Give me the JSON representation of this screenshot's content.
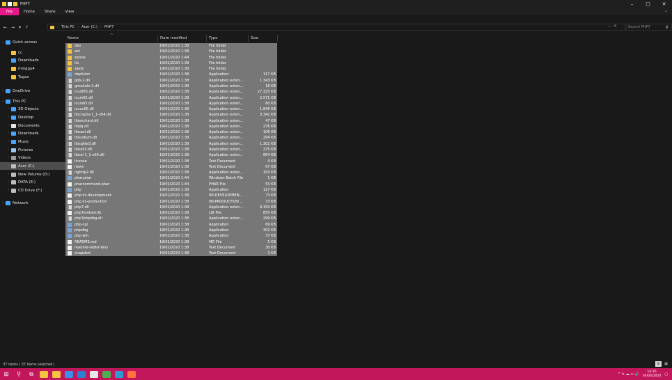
{
  "window": {
    "title": "PHP7",
    "controls": [
      "–",
      "□",
      "✕"
    ]
  },
  "ribbon": {
    "tabs": [
      "File",
      "Home",
      "Share",
      "View"
    ]
  },
  "address": {
    "nav": [
      "←",
      "→",
      "▾",
      "↑"
    ],
    "crumbs": [
      "This PC",
      "Acer (C:)",
      "PHP7"
    ],
    "refresh": "⟳",
    "dropdown": "⌄",
    "search_placeholder": "Search PHP7"
  },
  "sidebar": {
    "items": [
      {
        "label": "Quick access",
        "icon": "star-icon",
        "color": "#4aa3ff",
        "chev": "⌄"
      },
      {
        "label": "cc",
        "icon": "folder-icon",
        "color": "#f5c542",
        "chev": ""
      },
      {
        "label": "Downloads",
        "icon": "download-icon",
        "color": "#4aa3ff",
        "chev": ""
      },
      {
        "label": "minggu4",
        "icon": "folder-icon",
        "color": "#f5c542",
        "chev": ""
      },
      {
        "label": "Tugas",
        "icon": "folder-icon",
        "color": "#f5c542",
        "chev": ""
      },
      {
        "label": "OneDrive",
        "icon": "cloud-icon",
        "color": "#4aa3ff",
        "chev": "›"
      },
      {
        "label": "This PC",
        "icon": "computer-icon",
        "color": "#4aa3ff",
        "chev": "⌄"
      },
      {
        "label": "3D Objects",
        "icon": "cube-icon",
        "color": "#4aa3ff",
        "chev": "›"
      },
      {
        "label": "Desktop",
        "icon": "desktop-icon",
        "color": "#4aa3ff",
        "chev": "›"
      },
      {
        "label": "Documents",
        "icon": "document-icon",
        "color": "#e6e6e6",
        "chev": "›"
      },
      {
        "label": "Downloads",
        "icon": "download-icon",
        "color": "#4aa3ff",
        "chev": "›"
      },
      {
        "label": "Music",
        "icon": "music-icon",
        "color": "#4aa3ff",
        "chev": "›"
      },
      {
        "label": "Pictures",
        "icon": "pictures-icon",
        "color": "#9ac7f0",
        "chev": "›"
      },
      {
        "label": "Videos",
        "icon": "video-icon",
        "color": "#9a9a9a",
        "chev": "›"
      },
      {
        "label": "Acer (C:)",
        "icon": "drive-icon",
        "color": "#bdbdbd",
        "chev": "›"
      },
      {
        "label": "New Volume (D:)",
        "icon": "drive-icon",
        "color": "#bdbdbd",
        "chev": "›"
      },
      {
        "label": "DATA (E:)",
        "icon": "drive-icon",
        "color": "#bdbdbd",
        "chev": "›"
      },
      {
        "label": "CD Drive (F:)",
        "icon": "cd-drive-icon",
        "color": "#bdbdbd",
        "chev": "›"
      },
      {
        "label": "Network",
        "icon": "network-icon",
        "color": "#4aa3ff",
        "chev": "›"
      }
    ]
  },
  "columns": {
    "name": "Name",
    "date": "Date modified",
    "type": "Type",
    "size": "Size",
    "sort_indicator": "^"
  },
  "files": [
    {
      "name": "dev",
      "date": "19/02/2020 1:38",
      "type": "File folder",
      "size": "",
      "kind": "folder"
    },
    {
      "name": "ext",
      "date": "19/02/2020 1:38",
      "type": "File folder",
      "size": "",
      "kind": "folder"
    },
    {
      "name": "extras",
      "date": "19/02/2020 1:44",
      "type": "File folder",
      "size": "",
      "kind": "folder"
    },
    {
      "name": "lib",
      "date": "19/02/2020 1:38",
      "type": "File folder",
      "size": "",
      "kind": "folder"
    },
    {
      "name": "sasl2",
      "date": "19/02/2020 1:38",
      "type": "File folder",
      "size": "",
      "kind": "folder"
    },
    {
      "name": "deplister",
      "date": "19/02/2020 1:38",
      "type": "Application",
      "size": "117 KB",
      "kind": "app"
    },
    {
      "name": "glib-2.dll",
      "date": "19/02/2020 1:38",
      "type": "Application exten...",
      "size": "1.343 KB",
      "kind": "dll"
    },
    {
      "name": "gmodule-2.dll",
      "date": "19/02/2020 1:38",
      "type": "Application exten...",
      "size": "18 KB",
      "kind": "dll"
    },
    {
      "name": "icudt65.dll",
      "date": "19/02/2020 1:38",
      "type": "Application exten...",
      "size": "27.325 KB",
      "kind": "dll"
    },
    {
      "name": "icuin65.dll",
      "date": "19/02/2020 1:38",
      "type": "Application exten...",
      "size": "2.571 KB",
      "kind": "dll"
    },
    {
      "name": "icuio65.dll",
      "date": "19/02/2020 1:38",
      "type": "Application exten...",
      "size": "60 KB",
      "kind": "dll"
    },
    {
      "name": "icuuc65.dll",
      "date": "19/02/2020 1:38",
      "type": "Application exten...",
      "size": "1.846 KB",
      "kind": "dll"
    },
    {
      "name": "libcrypto-1_1-x64.dll",
      "date": "19/02/2020 1:38",
      "type": "Application exten...",
      "size": "3.342 KB",
      "kind": "dll"
    },
    {
      "name": "libenchant.dll",
      "date": "19/02/2020 1:38",
      "type": "Application exten...",
      "size": "47 KB",
      "kind": "dll"
    },
    {
      "name": "libpq.dll",
      "date": "19/02/2020 1:38",
      "type": "Application exten...",
      "size": "276 KB",
      "kind": "dll"
    },
    {
      "name": "libsasl.dll",
      "date": "19/02/2020 1:38",
      "type": "Application exten...",
      "size": "106 KB",
      "kind": "dll"
    },
    {
      "name": "libsodium.dll",
      "date": "19/02/2020 1:38",
      "type": "Application exten...",
      "size": "294 KB",
      "kind": "dll"
    },
    {
      "name": "libsqlite3.dll",
      "date": "19/02/2020 1:38",
      "type": "Application exten...",
      "size": "1.302 KB",
      "kind": "dll"
    },
    {
      "name": "libssh2.dll",
      "date": "19/02/2020 1:38",
      "type": "Application exten...",
      "size": "275 KB",
      "kind": "dll"
    },
    {
      "name": "libssl-1_1-x64.dll",
      "date": "19/02/2020 1:38",
      "type": "Application exten...",
      "size": "664 KB",
      "kind": "dll"
    },
    {
      "name": "license",
      "date": "19/02/2020 1:38",
      "type": "Text Document",
      "size": "4 KB",
      "kind": "file"
    },
    {
      "name": "news",
      "date": "19/02/2020 1:38",
      "type": "Text Document",
      "size": "67 KB",
      "kind": "file"
    },
    {
      "name": "nghttp2.dll",
      "date": "19/02/2020 1:38",
      "type": "Application exten...",
      "size": "193 KB",
      "kind": "dll"
    },
    {
      "name": "phar.phar",
      "date": "19/02/2020 1:44",
      "type": "Windows Batch File",
      "size": "1 KB",
      "kind": "app"
    },
    {
      "name": "pharcommand.phar",
      "date": "19/02/2020 1:44",
      "type": "PHAR File",
      "size": "53 KB",
      "kind": "file"
    },
    {
      "name": "php",
      "date": "19/02/2020 1:38",
      "type": "Application",
      "size": "127 KB",
      "kind": "app"
    },
    {
      "name": "php.ini-development",
      "date": "19/02/2020 1:38",
      "type": "INI-DEVELOPMEN...",
      "size": "73 KB",
      "kind": "file"
    },
    {
      "name": "php.ini-production",
      "date": "19/02/2020 1:38",
      "type": "INI-PRODUCTION ...",
      "size": "73 KB",
      "kind": "file"
    },
    {
      "name": "php7.dll",
      "date": "19/02/2020 1:38",
      "type": "Application exten...",
      "size": "9.150 KB",
      "kind": "dll"
    },
    {
      "name": "php7embed.lib",
      "date": "19/02/2020 1:38",
      "type": "LIB File",
      "size": "855 KB",
      "kind": "file"
    },
    {
      "name": "php7phpdbg.dll",
      "date": "19/02/2020 1:38",
      "type": "Application exten...",
      "size": "299 KB",
      "kind": "dll"
    },
    {
      "name": "php-cgi",
      "date": "19/02/2020 1:38",
      "type": "Application",
      "size": "69 KB",
      "kind": "app"
    },
    {
      "name": "phpdbg",
      "date": "19/02/2020 1:38",
      "type": "Application",
      "size": "302 KB",
      "kind": "app"
    },
    {
      "name": "php-win",
      "date": "19/02/2020 1:38",
      "type": "Application",
      "size": "37 KB",
      "kind": "app"
    },
    {
      "name": "README.md",
      "date": "19/02/2020 1:38",
      "type": "MD File",
      "size": "5 KB",
      "kind": "file"
    },
    {
      "name": "readme-redist-bins",
      "date": "19/02/2020 1:38",
      "type": "Text Document",
      "size": "30 KB",
      "kind": "file"
    },
    {
      "name": "snapshot",
      "date": "19/02/2020 1:38",
      "type": "Text Document",
      "size": "3 KB",
      "kind": "file"
    }
  ],
  "status": {
    "text": "37 items  |  37 items selected  |"
  },
  "taskbar": {
    "start": "⊞",
    "search": "⚲",
    "taskview": "⧉",
    "apps": [
      {
        "icon": "store-icon",
        "color": "#f5c542"
      },
      {
        "icon": "file-explorer-icon",
        "color": "#f5c542"
      },
      {
        "icon": "vscode-icon",
        "color": "#3b8eea"
      },
      {
        "icon": "edge-icon",
        "color": "#2f7fd1"
      },
      {
        "icon": "chrome-icon",
        "color": "#e8e8e8"
      },
      {
        "icon": "photos-icon",
        "color": "#4caf50"
      },
      {
        "icon": "xampp-icon",
        "color": "#2f9ad1"
      },
      {
        "icon": "app-icon",
        "color": "#ff7043"
      }
    ],
    "tray": {
      "time": "14:16",
      "date": "04/04/2020",
      "icons": "^  ✎  ☁  ▭  🔊"
    }
  }
}
